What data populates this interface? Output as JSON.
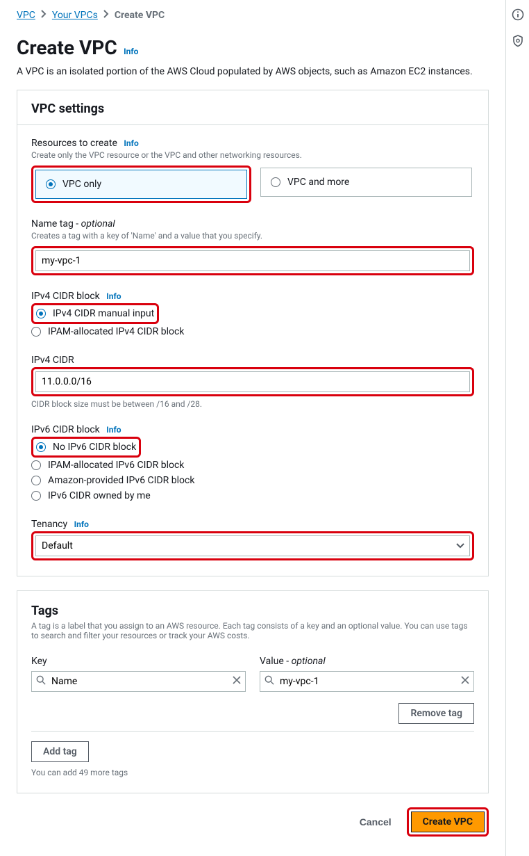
{
  "breadcrumb": {
    "items": [
      "VPC",
      "Your VPCs"
    ],
    "current": "Create VPC"
  },
  "header": {
    "title": "Create VPC",
    "info": "Info",
    "description": "A VPC is an isolated portion of the AWS Cloud populated by AWS objects, such as Amazon EC2 instances."
  },
  "settings": {
    "panel_title": "VPC settings",
    "resources": {
      "label": "Resources to create",
      "info": "Info",
      "desc": "Create only the VPC resource or the VPC and other networking resources.",
      "option1": "VPC only",
      "option2": "VPC and more"
    },
    "name_tag": {
      "label": "Name tag - ",
      "optional": "optional",
      "desc": "Creates a tag with a key of 'Name' and a value that you specify.",
      "value": "my-vpc-1"
    },
    "ipv4_block": {
      "label": "IPv4 CIDR block",
      "info": "Info",
      "option1": "IPv4 CIDR manual input",
      "option2": "IPAM-allocated IPv4 CIDR block"
    },
    "ipv4_cidr": {
      "label": "IPv4 CIDR",
      "value": "11.0.0.0/16",
      "hint": "CIDR block size must be between /16 and /28."
    },
    "ipv6_block": {
      "label": "IPv6 CIDR block",
      "info": "Info",
      "option1": "No IPv6 CIDR block",
      "option2": "IPAM-allocated IPv6 CIDR block",
      "option3": "Amazon-provided IPv6 CIDR block",
      "option4": "IPv6 CIDR owned by me"
    },
    "tenancy": {
      "label": "Tenancy",
      "info": "Info",
      "value": "Default"
    }
  },
  "tags": {
    "panel_title": "Tags",
    "desc": "A tag is a label that you assign to an AWS resource. Each tag consists of a key and an optional value. You can use tags to search and filter your resources or track your AWS costs.",
    "key_label": "Key",
    "value_label": "Value - ",
    "value_optional": "optional",
    "key_value": "Name",
    "value_value": "my-vpc-1",
    "remove_btn": "Remove tag",
    "add_btn": "Add tag",
    "count_hint": "You can add 49 more tags"
  },
  "footer": {
    "cancel": "Cancel",
    "submit": "Create VPC"
  }
}
